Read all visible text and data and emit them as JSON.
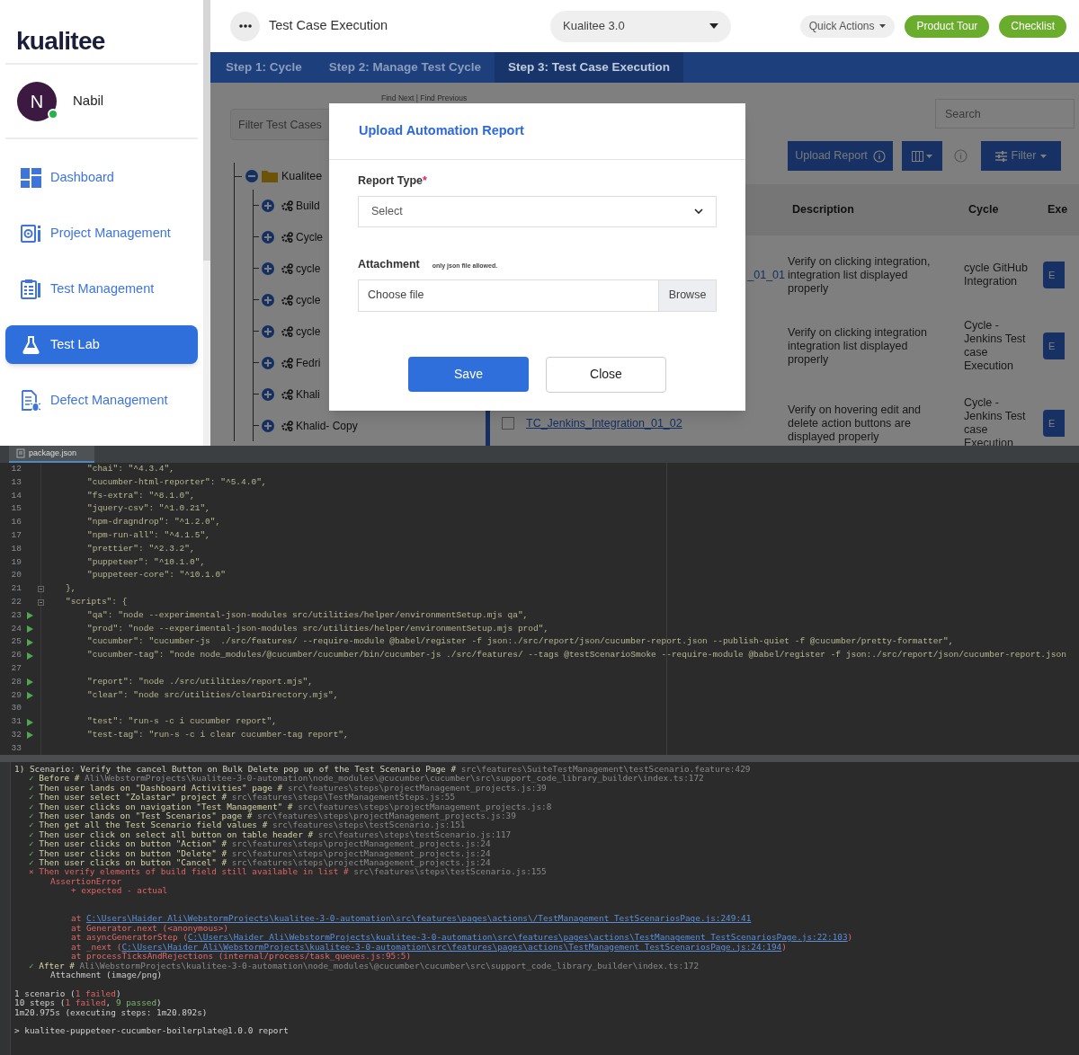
{
  "sidebar": {
    "logo": "kualitee",
    "user": {
      "initial": "N",
      "name": "Nabil",
      "online": true
    },
    "items": [
      {
        "label": "Dashboard",
        "selected": false
      },
      {
        "label": "Project Management",
        "selected": false
      },
      {
        "label": "Test Management",
        "selected": false
      },
      {
        "label": "Test Lab",
        "selected": true
      },
      {
        "label": "Defect Management",
        "selected": false
      }
    ]
  },
  "header": {
    "title": "Test Case Execution",
    "project": "Kualitee 3.0",
    "buttons": [
      {
        "label": "Quick Actions",
        "kind": "menu"
      },
      {
        "label": "Product Tour",
        "kind": "primary"
      },
      {
        "label": "Checklist",
        "kind": "primary"
      }
    ]
  },
  "steps": [
    {
      "label": "Step 1: Cycle",
      "selected": false
    },
    {
      "label": "Step 2: Manage Test Cycle",
      "selected": false
    },
    {
      "label": "Step 3: Test Case Execution",
      "selected": true
    }
  ],
  "workspace": {
    "find_links": "Find Next | Find Previous",
    "filter": {
      "placeholder": "Filter Test Cases"
    },
    "tree": {
      "label": "Kualitee",
      "expanded": true,
      "children": [
        {
          "label": "Build",
          "expanded": false
        },
        {
          "label": "Cycle",
          "expanded": false
        },
        {
          "label": "cycle",
          "expanded": false
        },
        {
          "label": "cycle",
          "expanded": false
        },
        {
          "label": "cycle",
          "expanded": false
        },
        {
          "label": "Fedri",
          "expanded": false
        },
        {
          "label": "Khali",
          "expanded": false
        },
        {
          "label": "Khalid- Copy",
          "expanded": false
        }
      ]
    },
    "search": {
      "placeholder": "Search"
    },
    "toolbar": {
      "upload": "Upload Report",
      "filter": "Filter"
    },
    "table": {
      "columns": [
        "Description",
        "Cycle",
        "Exe"
      ],
      "rows": [
        {
          "kind": "clipped",
          "id": "_01_01",
          "description": "Verify on clicking integration, integration list displayed properly",
          "cycle": "cycle GitHub Integration",
          "action": "E"
        },
        {
          "kind": "covered",
          "description": "Verify on clicking integration integration list displayed properly",
          "cycle": "Cycle - Jenkins Test case Execution",
          "action": "E"
        },
        {
          "kind": "full",
          "checked": false,
          "id": "TC_Jenkins_Integration_01_02",
          "description": "Verify on hovering edit and delete action buttons are displayed properly",
          "cycle": "Cycle - Jenkins Test case Execution",
          "action": "E"
        }
      ]
    }
  },
  "modal": {
    "title": "Upload Automation Report",
    "fields": [
      {
        "kind": "select",
        "label": "Report Type",
        "required_mark": "*",
        "value": "Select"
      },
      {
        "kind": "file",
        "label": "Attachment",
        "hint": "only json file allowed.",
        "placeholder": "Choose file",
        "button": "Browse"
      }
    ],
    "buttons": [
      {
        "label": "Save",
        "kind": "primary"
      },
      {
        "label": "Close",
        "kind": "secondary"
      }
    ]
  },
  "editor": {
    "tab": "package.json",
    "lines": [
      {
        "number": "12",
        "kind": "entry",
        "text": "\"chai\": \"^4.3.4\",",
        "run": false,
        "fold": false
      },
      {
        "number": "13",
        "kind": "entry",
        "text": "\"cucumber-html-reporter\": \"^5.4.0\",",
        "run": false,
        "fold": false
      },
      {
        "number": "14",
        "kind": "entry",
        "text": "\"fs-extra\": \"^8.1.0\",",
        "run": false,
        "fold": false
      },
      {
        "number": "15",
        "kind": "entry",
        "text": "\"jquery-csv\": \"^1.0.21\",",
        "run": false,
        "fold": false
      },
      {
        "number": "16",
        "kind": "entry",
        "text": "\"npm-dragndrop\": \"^1.2.0\",",
        "run": false,
        "fold": false
      },
      {
        "number": "17",
        "kind": "entry",
        "text": "\"npm-run-all\": \"^4.1.5\",",
        "run": false,
        "fold": false
      },
      {
        "number": "18",
        "kind": "entry",
        "text": "\"prettier\": \"^2.3.2\",",
        "run": false,
        "fold": false
      },
      {
        "number": "19",
        "kind": "entry",
        "text": "\"puppeteer\": \"^10.1.0\",",
        "run": false,
        "fold": false
      },
      {
        "number": "20",
        "kind": "entry",
        "text": "\"puppeteer-core\": \"^10.1.0\"",
        "run": false,
        "fold": false
      },
      {
        "number": "21",
        "kind": "block",
        "text": "},",
        "run": false,
        "fold": true
      },
      {
        "number": "22",
        "kind": "block",
        "text": "\"scripts\": {",
        "run": false,
        "fold": true
      },
      {
        "number": "23",
        "kind": "entry",
        "text": "\"qa\": \"node --experimental-json-modules src/utilities/helper/environmentSetup.mjs qa\",",
        "run": true,
        "fold": false
      },
      {
        "number": "24",
        "kind": "entry",
        "text": "\"prod\": \"node --experimental-json-modules src/utilities/helper/environmentSetup.mjs prod\",",
        "run": true,
        "fold": false
      },
      {
        "number": "25",
        "kind": "entry",
        "text": "\"cucumber\": \"cucumber-js  ./src/features/ --require-module @babel/register -f json:./src/report/json/cucumber-report.json --publish-quiet -f @cucumber/pretty-formatter\",",
        "run": true,
        "fold": false
      },
      {
        "number": "26",
        "kind": "entry",
        "text": "\"cucumber-tag\": \"node node_modules/@cucumber/cucumber/bin/cucumber-js ./src/features/ --tags @testScenarioSmoke --require-module @babel/register -f json:./src/report/json/cucumber-report.json",
        "run": true,
        "fold": false
      },
      {
        "number": "27",
        "kind": "empty",
        "run": false,
        "fold": false
      },
      {
        "number": "28",
        "kind": "entry",
        "text": "\"report\": \"node ./src/utilities/report.mjs\",",
        "run": true,
        "fold": false
      },
      {
        "number": "29",
        "kind": "entry",
        "text": "\"clear\": \"node src/utilities/clearDirectory.mjs\",",
        "run": true,
        "fold": false
      },
      {
        "number": "30",
        "kind": "empty",
        "run": false,
        "fold": false
      },
      {
        "number": "31",
        "kind": "entry",
        "text": "\"test\": \"run-s -c i cucumber report\",",
        "run": true,
        "fold": false
      },
      {
        "number": "32",
        "kind": "entry",
        "text": "\"test-tag\": \"run-s -c i clear cucumber-tag report\",",
        "run": true,
        "fold": false
      },
      {
        "number": "33",
        "kind": "empty",
        "run": false,
        "fold": false
      }
    ]
  },
  "terminal": {
    "lines": [
      {
        "kind": "scenario",
        "segments": [
          {
            "kind": "text",
            "text": "1) Scenario: Verify the cancel Button on Bulk Delete pop up of the Test Scenario Page # "
          },
          {
            "kind": "source",
            "text": "src\\features\\SuiteTestManagement\\testScenario.feature:429"
          }
        ]
      },
      {
        "kind": "passed",
        "segments": [
          {
            "kind": "mark",
            "text": "✓"
          },
          {
            "kind": "text",
            "text": " Before # "
          },
          {
            "kind": "source",
            "text": "Ali\\WebstormProjects\\kualitee-3-0-automation\\node_modules\\@cucumber\\cucumber\\src\\support_code_library_builder\\index.ts:172"
          }
        ]
      },
      {
        "kind": "passed",
        "segments": [
          {
            "kind": "mark",
            "text": "✓"
          },
          {
            "kind": "text",
            "text": " Then user lands on \"Dashboard Activities\" page # "
          },
          {
            "kind": "source",
            "text": "src\\features\\steps\\projectManagement_projects.js:39"
          }
        ]
      },
      {
        "kind": "passed",
        "segments": [
          {
            "kind": "mark",
            "text": "✓"
          },
          {
            "kind": "text",
            "text": " Then user select \"Zolastar\" project # "
          },
          {
            "kind": "source",
            "text": "src\\features\\steps\\TestManagementSteps.js:55"
          }
        ]
      },
      {
        "kind": "passed",
        "segments": [
          {
            "kind": "mark",
            "text": "✓"
          },
          {
            "kind": "text",
            "text": " Then user clicks on navigation \"Test Management\" # "
          },
          {
            "kind": "source",
            "text": "src\\features\\steps\\projectManagement_projects.js:8"
          }
        ]
      },
      {
        "kind": "passed",
        "segments": [
          {
            "kind": "mark",
            "text": "✓"
          },
          {
            "kind": "text",
            "text": " Then user lands on \"Test Scenarios\" page # "
          },
          {
            "kind": "source",
            "text": "src\\features\\steps\\projectManagement_projects.js:39"
          }
        ]
      },
      {
        "kind": "passed",
        "segments": [
          {
            "kind": "mark",
            "text": "✓"
          },
          {
            "kind": "text",
            "text": " Then get all the Test Scenario field values # "
          },
          {
            "kind": "source",
            "text": "src\\features\\steps\\testScenario.js:151"
          }
        ]
      },
      {
        "kind": "passed",
        "segments": [
          {
            "kind": "mark",
            "text": "✓"
          },
          {
            "kind": "text",
            "text": " Then user click on select all button on table header # "
          },
          {
            "kind": "source",
            "text": "src\\features\\steps\\testScenario.js:117"
          }
        ]
      },
      {
        "kind": "passed",
        "segments": [
          {
            "kind": "mark",
            "text": "✓"
          },
          {
            "kind": "text",
            "text": " Then user clicks on button \"Action\" # "
          },
          {
            "kind": "source",
            "text": "src\\features\\steps\\projectManagement_projects.js:24"
          }
        ]
      },
      {
        "kind": "passed",
        "segments": [
          {
            "kind": "mark",
            "text": "✓"
          },
          {
            "kind": "text",
            "text": " Then user clicks on button \"Delete\" # "
          },
          {
            "kind": "source",
            "text": "src\\features\\steps\\projectManagement_projects.js:24"
          }
        ]
      },
      {
        "kind": "passed",
        "segments": [
          {
            "kind": "mark",
            "text": "✓"
          },
          {
            "kind": "text",
            "text": " Then user clicks on button \"Cancel\" # "
          },
          {
            "kind": "source",
            "text": "src\\features\\steps\\projectManagement_projects.js:24"
          }
        ]
      },
      {
        "kind": "failed",
        "segments": [
          {
            "kind": "mark",
            "text": "×"
          },
          {
            "kind": "text",
            "text": " Then verify elements of build field still available in list # "
          },
          {
            "kind": "source",
            "text": "src\\features\\steps\\testScenario.js:155"
          }
        ]
      },
      {
        "kind": "error",
        "segments": [
          {
            "kind": "text",
            "text": "AssertionError"
          }
        ]
      },
      {
        "kind": "diff",
        "segments": [
          {
            "kind": "text",
            "text": "+ expected - actual"
          }
        ]
      },
      {
        "kind": "blank"
      },
      {
        "kind": "blank"
      },
      {
        "kind": "trace",
        "segments": [
          {
            "kind": "text",
            "text": "at "
          },
          {
            "kind": "link",
            "text": "C:\\Users\\Haider Ali\\WebstormProjects\\kualitee-3-0-automation\\src\\features\\pages\\actions\\/TestManagement_TestScenariosPage.js:249:41"
          }
        ]
      },
      {
        "kind": "trace",
        "segments": [
          {
            "kind": "text",
            "text": "at Generator.next (<anonymous>)"
          }
        ]
      },
      {
        "kind": "trace",
        "segments": [
          {
            "kind": "text",
            "text": "at asyncGeneratorStep ("
          },
          {
            "kind": "link",
            "text": "C:\\Users\\Haider Ali\\WebstormProjects\\kualitee-3-0-automation\\src\\features\\pages\\actions\\TestManagement_TestScenariosPage.js:22:103"
          },
          {
            "kind": "text",
            "text": ")"
          }
        ]
      },
      {
        "kind": "trace",
        "segments": [
          {
            "kind": "text",
            "text": "at _next ("
          },
          {
            "kind": "link",
            "text": "C:\\Users\\Haider Ali\\WebstormProjects\\kualitee-3-0-automation\\src\\features\\pages\\actions\\TestManagement_TestScenariosPage.js:24:194"
          },
          {
            "kind": "text",
            "text": ")"
          }
        ]
      },
      {
        "kind": "trace",
        "segments": [
          {
            "kind": "text",
            "text": "at processTicksAndRejections (internal/process/task_queues.js:95:5)"
          }
        ]
      },
      {
        "kind": "passed",
        "segments": [
          {
            "kind": "mark",
            "text": "✓"
          },
          {
            "kind": "text",
            "text": " After # "
          },
          {
            "kind": "source",
            "text": "Ali\\WebstormProjects\\kualitee-3-0-automation\\node_modules\\@cucumber\\cucumber\\src\\support_code_library_builder\\index.ts:172"
          }
        ]
      },
      {
        "kind": "attachment",
        "segments": [
          {
            "kind": "text",
            "text": "Attachment (image/png)"
          }
        ]
      },
      {
        "kind": "blank"
      },
      {
        "kind": "summary",
        "segments": [
          {
            "kind": "text",
            "text": "1 scenario ("
          },
          {
            "kind": "failed",
            "text": "1 failed"
          },
          {
            "kind": "text",
            "text": ")"
          }
        ]
      },
      {
        "kind": "summary",
        "segments": [
          {
            "kind": "text",
            "text": "10 steps ("
          },
          {
            "kind": "failed",
            "text": "1 failed"
          },
          {
            "kind": "text",
            "text": ", "
          },
          {
            "kind": "passed",
            "text": "9 passed"
          },
          {
            "kind": "text",
            "text": ")"
          }
        ]
      },
      {
        "kind": "summary",
        "segments": [
          {
            "kind": "text",
            "text": "1m20.975s (executing steps: 1m20.892s)"
          }
        ]
      },
      {
        "kind": "blank"
      },
      {
        "kind": "prompt",
        "segments": [
          {
            "kind": "text",
            "text": "> kualitee-puppeteer-cucumber-boilerplate@1.0.0 report"
          }
        ]
      }
    ]
  }
}
